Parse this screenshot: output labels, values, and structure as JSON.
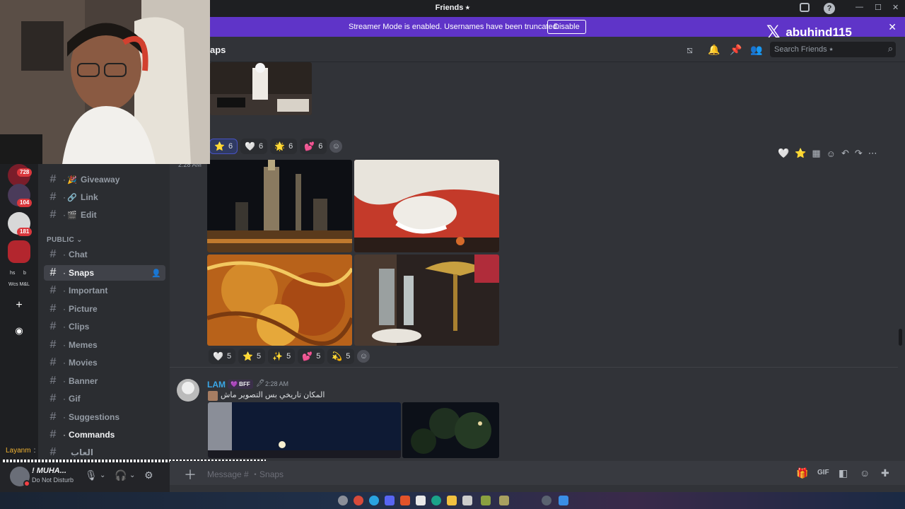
{
  "titlebar": {
    "title": "Friends ⭑"
  },
  "banner": {
    "message": "Streamer Mode is enabled. Usernames have been truncated.",
    "disable_label": "Disable"
  },
  "watermark": {
    "handle": "abuhind115"
  },
  "rail": {
    "badges": [
      "728",
      "104",
      "181"
    ],
    "labels": [
      "hs",
      "b",
      "Wcs M&L"
    ]
  },
  "sidebar": {
    "top_channels": [
      {
        "label": "Giveaway",
        "icon": "🎉"
      },
      {
        "label": "Link",
        "icon": "🔗"
      },
      {
        "label": "Edit",
        "icon": "🎬"
      }
    ],
    "category": "PUBLIC ⌄",
    "channels": [
      {
        "label": "Chat"
      },
      {
        "label": "Snaps"
      },
      {
        "label": "Important"
      },
      {
        "label": "Picture"
      },
      {
        "label": "Clips"
      },
      {
        "label": "Memes"
      },
      {
        "label": "Movies"
      },
      {
        "label": "Banner"
      },
      {
        "label": "Gif"
      },
      {
        "label": "Suggestions"
      },
      {
        "label": "Commands"
      },
      {
        "label": "العاب"
      }
    ]
  },
  "activity": {
    "name": "Layanm",
    "arrow": ":"
  },
  "user": {
    "name": "! MUHA...",
    "status": "Do Not Disturb"
  },
  "header": {
    "channel": "aps",
    "search_placeholder": "Search Friends ⭑"
  },
  "message1": {
    "reactions": [
      {
        "emoji": "⭐",
        "count": "6"
      },
      {
        "emoji": "🤍",
        "count": "6"
      },
      {
        "emoji": "🌟",
        "count": "6"
      },
      {
        "emoji": "💕",
        "count": "6"
      }
    ],
    "timestamp": "2:28 AM"
  },
  "message2": {
    "reactions": [
      {
        "emoji": "🤍",
        "count": "5"
      },
      {
        "emoji": "⭐",
        "count": "5"
      },
      {
        "emoji": "✨",
        "count": "5"
      },
      {
        "emoji": "💕",
        "count": "5"
      },
      {
        "emoji": "💫",
        "count": "5"
      }
    ]
  },
  "message3": {
    "author": "LAM",
    "badge": "💜 BFF",
    "pen": "🖊",
    "timestamp": "2:28 AM",
    "text": "المكان تاريخي بس التصوير ماش"
  },
  "composer": {
    "placeholder": "Message # ・Snaps"
  },
  "colors": {
    "banner": "#5f34c8",
    "lam_name": "#3aa7e8",
    "dnd": "#f23f43"
  }
}
